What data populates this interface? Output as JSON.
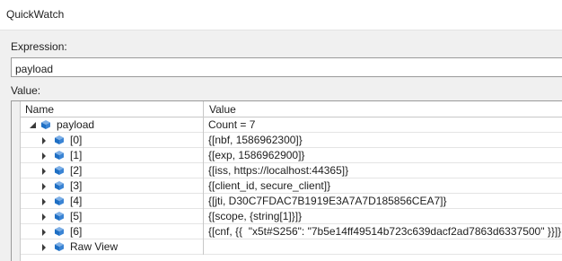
{
  "window": {
    "title": "QuickWatch"
  },
  "expression": {
    "label": "Expression:",
    "value": "payload"
  },
  "value_section": {
    "label": "Value:"
  },
  "grid": {
    "headers": {
      "name": "Name",
      "value": "Value"
    },
    "root": {
      "name": "payload",
      "value": "Count = 7"
    },
    "rows": [
      {
        "name": "[0]",
        "value": "{[nbf, 1586962300]}"
      },
      {
        "name": "[1]",
        "value": "{[exp, 1586962900]}"
      },
      {
        "name": "[2]",
        "value": "{[iss, https://localhost:44365]}"
      },
      {
        "name": "[3]",
        "value": "{[client_id, secure_client]}"
      },
      {
        "name": "[4]",
        "value": "{[jti, D30C7FDAC7B1919E3A7A7D185856CEA7]}"
      },
      {
        "name": "[5]",
        "value": "{[scope, {string[1]}]}"
      },
      {
        "name": "[6]",
        "value": "{[cnf, {{  \"x5t#S256\": \"7b5e14ff49514b723c639dacf2ad7863d6337500\" }}]}"
      },
      {
        "name": "Raw View",
        "value": ""
      }
    ]
  },
  "colors": {
    "cube_blue": "#1e6fc4",
    "cube_light": "#7fb0e6",
    "panel_bg": "#f0f0f0"
  },
  "icons": {
    "expand": "expand-arrow-icon",
    "collapse": "collapse-arrow-icon",
    "field": "field-cube-icon"
  }
}
